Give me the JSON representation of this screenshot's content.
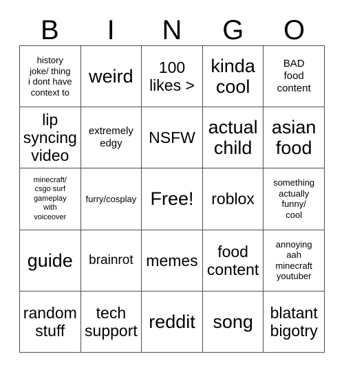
{
  "card": {
    "title": "BINGO",
    "background_color": "#ffffff",
    "text_color": "#000000",
    "border_color": "#4d4d4d"
  },
  "header": {
    "letters": [
      {
        "label": "B"
      },
      {
        "label": "I"
      },
      {
        "label": "N"
      },
      {
        "label": "G"
      },
      {
        "label": "O"
      }
    ]
  },
  "grid": {
    "rows": 5,
    "columns": 5,
    "free_space": {
      "row": 2,
      "column": 2,
      "label": "Free!"
    },
    "cells": [
      {
        "id": "b1",
        "column": "B",
        "row": 1,
        "label": "history\njoke/ thing\ni dont have\ncontext to",
        "size": "fs-sm"
      },
      {
        "id": "i1",
        "column": "I",
        "row": 1,
        "label": "weird",
        "size": "fs-xxl"
      },
      {
        "id": "n1",
        "column": "N",
        "row": 1,
        "label": "100\nlikes >",
        "size": "fs-xl"
      },
      {
        "id": "g1",
        "column": "G",
        "row": 1,
        "label": "kinda\ncool",
        "size": "fs-xxl"
      },
      {
        "id": "o1",
        "column": "O",
        "row": 1,
        "label": "BAD\nfood\ncontent",
        "size": "fs-md"
      },
      {
        "id": "b2",
        "column": "B",
        "row": 2,
        "label": "lip\nsyncing\nvideo",
        "size": "fs-xl"
      },
      {
        "id": "i2",
        "column": "I",
        "row": 2,
        "label": "extremely\nedgy",
        "size": "fs-md"
      },
      {
        "id": "n2",
        "column": "N",
        "row": 2,
        "label": "NSFW",
        "size": "fs-xl"
      },
      {
        "id": "g2",
        "column": "G",
        "row": 2,
        "label": "actual\nchild",
        "size": "fs-xxl"
      },
      {
        "id": "o2",
        "column": "O",
        "row": 2,
        "label": "asian\nfood",
        "size": "fs-xxl"
      },
      {
        "id": "b3",
        "column": "B",
        "row": 3,
        "label": "minecraft/\ncsgo surf\ngameplay\nwith\nvoiceover",
        "size": "fs-xs"
      },
      {
        "id": "i3",
        "column": "I",
        "row": 3,
        "label": "furry/cosplay",
        "size": "fs-sm"
      },
      {
        "id": "n3",
        "column": "N",
        "row": 3,
        "label": "Free!",
        "size": "fs-free"
      },
      {
        "id": "g3",
        "column": "G",
        "row": 3,
        "label": "roblox",
        "size": "fs-xl"
      },
      {
        "id": "o3",
        "column": "O",
        "row": 3,
        "label": "something\nactually\nfunny/\ncool",
        "size": "fs-sm"
      },
      {
        "id": "b4",
        "column": "B",
        "row": 4,
        "label": "guide",
        "size": "fs-xxl"
      },
      {
        "id": "i4",
        "column": "I",
        "row": 4,
        "label": "brainrot",
        "size": "fs-lg"
      },
      {
        "id": "n4",
        "column": "N",
        "row": 4,
        "label": "memes",
        "size": "fs-xl"
      },
      {
        "id": "g4",
        "column": "G",
        "row": 4,
        "label": "food\ncontent",
        "size": "fs-xl"
      },
      {
        "id": "o4",
        "column": "O",
        "row": 4,
        "label": "annoying\naah\nminecraft\nyoutuber",
        "size": "fs-sm"
      },
      {
        "id": "b5",
        "column": "B",
        "row": 5,
        "label": "random\nstuff",
        "size": "fs-xl"
      },
      {
        "id": "i5",
        "column": "I",
        "row": 5,
        "label": "tech\nsupport",
        "size": "fs-xl"
      },
      {
        "id": "n5",
        "column": "N",
        "row": 5,
        "label": "reddit",
        "size": "fs-xxl"
      },
      {
        "id": "g5",
        "column": "G",
        "row": 5,
        "label": "song",
        "size": "fs-xxl"
      },
      {
        "id": "o5",
        "column": "O",
        "row": 5,
        "label": "blatant\nbigotry",
        "size": "fs-xl"
      }
    ]
  }
}
